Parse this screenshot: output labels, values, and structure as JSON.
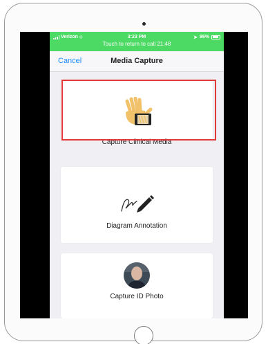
{
  "status_bar": {
    "carrier": "Verizon",
    "time": "3:23 PM",
    "battery": "86%",
    "call_banner": "Touch to return to call 21:48",
    "color": "#4cd964"
  },
  "nav": {
    "cancel_label": "Cancel",
    "title": "Media Capture"
  },
  "options": [
    {
      "label": "Capture Clinical Media",
      "icon": "hand-phone-icon",
      "selected": true
    },
    {
      "label": "Diagram Annotation",
      "icon": "signature-pen-icon",
      "selected": false
    },
    {
      "label": "Capture ID Photo",
      "icon": "avatar",
      "selected": false
    }
  ],
  "colors": {
    "accent": "#1a8cff",
    "highlight": "#e0393a",
    "background": "#efeff4"
  }
}
